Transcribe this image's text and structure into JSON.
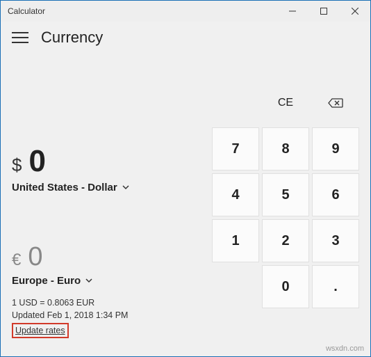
{
  "window": {
    "title": "Calculator"
  },
  "header": {
    "mode": "Currency"
  },
  "from": {
    "symbol": "$",
    "value": "0",
    "currency_label": "United States - Dollar"
  },
  "to": {
    "symbol": "€",
    "value": "0",
    "currency_label": "Europe - Euro"
  },
  "rate": {
    "line": "1 USD = 0.8063 EUR",
    "updated": "Updated Feb 1, 2018 1:34 PM",
    "update_link": "Update rates"
  },
  "keypad": {
    "ce": "CE",
    "k7": "7",
    "k8": "8",
    "k9": "9",
    "k4": "4",
    "k5": "5",
    "k6": "6",
    "k1": "1",
    "k2": "2",
    "k3": "3",
    "k0": "0",
    "dot": "."
  },
  "watermark": "wsxdn.com"
}
